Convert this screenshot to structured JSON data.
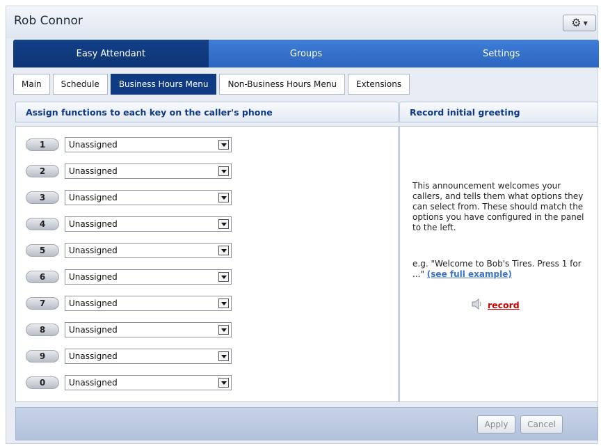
{
  "window": {
    "title": "Rob Connor",
    "settings_icon": "gear-icon"
  },
  "main_nav": {
    "items": [
      {
        "label": "Easy Attendant",
        "active": true
      },
      {
        "label": "Groups",
        "active": false
      },
      {
        "label": "Settings",
        "active": false
      }
    ]
  },
  "sub_tabs": {
    "items": [
      {
        "label": "Main",
        "active": false
      },
      {
        "label": "Schedule",
        "active": false
      },
      {
        "label": "Business Hours Menu",
        "active": true
      },
      {
        "label": "Non-Business Hours Menu",
        "active": false
      },
      {
        "label": "Extensions",
        "active": false
      }
    ]
  },
  "left_panel": {
    "title": "Assign functions to each key on the caller's phone",
    "keys": [
      {
        "key": "1",
        "value": "Unassigned"
      },
      {
        "key": "2",
        "value": "Unassigned"
      },
      {
        "key": "3",
        "value": "Unassigned"
      },
      {
        "key": "4",
        "value": "Unassigned"
      },
      {
        "key": "5",
        "value": "Unassigned"
      },
      {
        "key": "6",
        "value": "Unassigned"
      },
      {
        "key": "7",
        "value": "Unassigned"
      },
      {
        "key": "8",
        "value": "Unassigned"
      },
      {
        "key": "9",
        "value": "Unassigned"
      },
      {
        "key": "0",
        "value": "Unassigned"
      }
    ]
  },
  "right_panel": {
    "title": "Record initial greeting",
    "description": "This announcement welcomes your callers, and tells them what options they can select from. These should match the options you have configured in the panel to the left.",
    "example_text": "e.g. \"Welcome to Bob's Tires. Press 1 for ...\"",
    "see_full_link": "(see full example)",
    "record_label": "record",
    "record_icon": "speaker-icon"
  },
  "footer": {
    "apply_label": "Apply",
    "cancel_label": "Cancel"
  },
  "colors": {
    "nav_active": "#0e3575",
    "nav_inactive": "#2c66c1",
    "panel_title": "#0d3a8a",
    "link": "#3b74c9",
    "record_link": "#cc0000"
  }
}
